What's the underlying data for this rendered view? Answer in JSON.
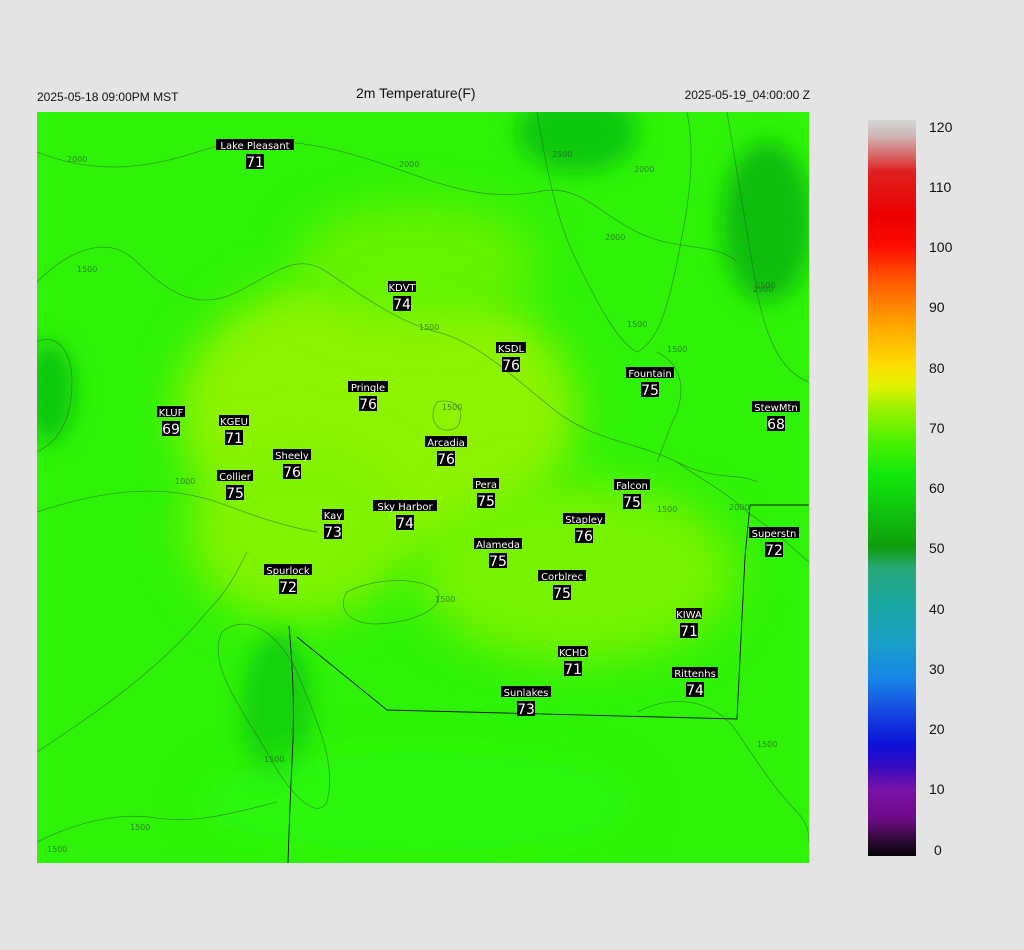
{
  "header": {
    "local_time": "2025-05-18 09:00PM MST",
    "title": "2m Temperature(F)",
    "utc_time": "2025-05-19_04:00:00 Z"
  },
  "colorbar": {
    "ticks": [
      "120",
      "110",
      "100",
      "90",
      "80",
      "70",
      "60",
      "50",
      "40",
      "30",
      "20",
      "10",
      "0"
    ],
    "min": 0,
    "max": 120
  },
  "contour_labels": [
    "2000",
    "2500",
    "2000",
    "2000",
    "2000",
    "1500",
    "1500",
    "1500",
    "1500",
    "2500",
    "1500",
    "1000",
    "2000",
    "1500",
    "1500",
    "1500",
    "1500",
    "1500",
    "1500",
    "2500"
  ],
  "stations": [
    {
      "name": "Lake Pleasant",
      "value": "71"
    },
    {
      "name": "KDVT",
      "value": "74"
    },
    {
      "name": "KSDL",
      "value": "76"
    },
    {
      "name": "Fountain",
      "value": "75"
    },
    {
      "name": "StewMtn",
      "value": "68"
    },
    {
      "name": "Pringle",
      "value": "76"
    },
    {
      "name": "KLUF",
      "value": "69"
    },
    {
      "name": "KGEU",
      "value": "71"
    },
    {
      "name": "Arcadia",
      "value": "76"
    },
    {
      "name": "Sheely",
      "value": "76"
    },
    {
      "name": "Collier",
      "value": "75"
    },
    {
      "name": "Pera",
      "value": "75"
    },
    {
      "name": "Falcon",
      "value": "75"
    },
    {
      "name": "Kay",
      "value": "73"
    },
    {
      "name": "Sky Harbor",
      "value": "74"
    },
    {
      "name": "Stapley",
      "value": "76"
    },
    {
      "name": "Superstn",
      "value": "72"
    },
    {
      "name": "Alameda",
      "value": "75"
    },
    {
      "name": "Spurlock",
      "value": "72"
    },
    {
      "name": "Corblrec",
      "value": "75"
    },
    {
      "name": "KIWA",
      "value": "71"
    },
    {
      "name": "KCHD",
      "value": "71"
    },
    {
      "name": "Rittenhs",
      "value": "74"
    },
    {
      "name": "Sunlakes",
      "value": "73"
    }
  ]
}
